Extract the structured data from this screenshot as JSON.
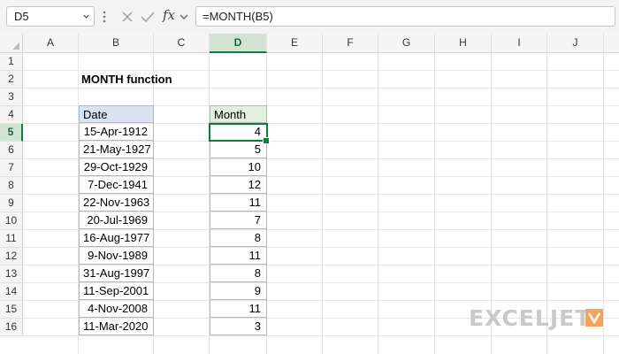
{
  "formula_bar": {
    "name_box": "D5",
    "fx_label": "fx",
    "formula": "=MONTH(B5)"
  },
  "columns": [
    "A",
    "B",
    "C",
    "D",
    "E",
    "F",
    "G",
    "H",
    "I",
    "J"
  ],
  "selected_column": "D",
  "rows": [
    "1",
    "2",
    "3",
    "4",
    "5",
    "6",
    "7",
    "8",
    "9",
    "10",
    "11",
    "12",
    "13",
    "14",
    "15",
    "16"
  ],
  "selected_row": "5",
  "sheet": {
    "title": "MONTH function",
    "date_header": "Date",
    "month_header": "Month",
    "dates": [
      "15-Apr-1912",
      "21-May-1927",
      "29-Oct-1929",
      "7-Dec-1941",
      "22-Nov-1963",
      "20-Jul-1969",
      "16-Aug-1977",
      "9-Nov-1989",
      "31-Aug-1997",
      "11-Sep-2001",
      "4-Nov-2008",
      "11-Mar-2020"
    ],
    "months": [
      "4",
      "5",
      "10",
      "12",
      "11",
      "7",
      "8",
      "11",
      "8",
      "9",
      "11",
      "3"
    ]
  },
  "watermark": {
    "text": "EXCELJET",
    "color": "#c9c9c9",
    "accent": "#f5a35c"
  },
  "colors": {
    "accent": "#107c41",
    "date_header_fill": "#dae3f3",
    "month_header_fill": "#e2efda"
  }
}
